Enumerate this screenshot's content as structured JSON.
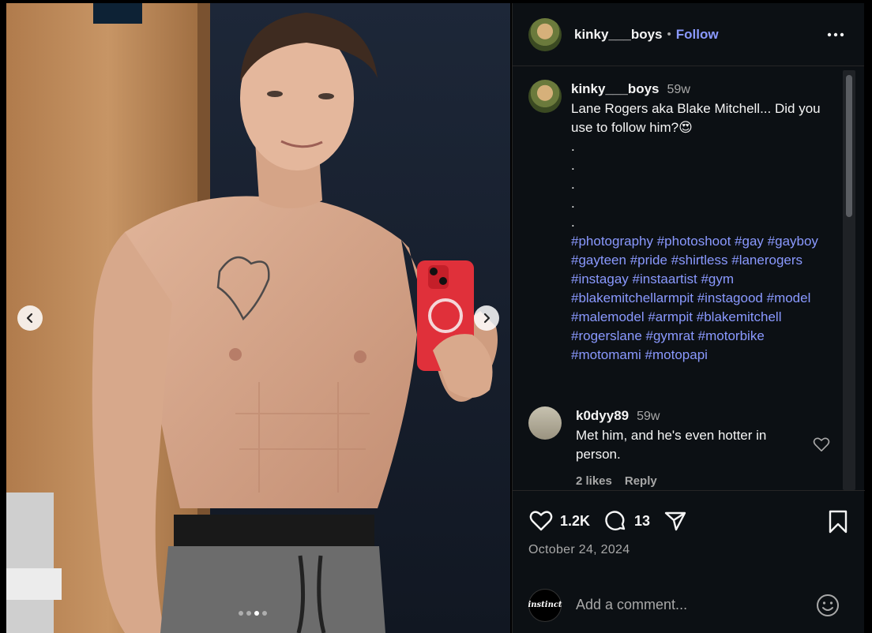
{
  "post": {
    "username": "kinky___boys",
    "separator": "•",
    "follow_label": "Follow",
    "more_label": "More options"
  },
  "caption": {
    "username": "kinky___boys",
    "time": "59w",
    "text": "Lane Rogers aka Blake Mitchell... Did you use to follow him?😍",
    "dots": [
      ".",
      ".",
      ".",
      ".",
      "."
    ],
    "hashtags": [
      "#photography",
      "#photoshoot",
      "#gay",
      "#gayboy",
      "#gayteen",
      "#pride",
      "#shirtless",
      "#lanerogers",
      "#instagay",
      "#instaartist",
      "#gym",
      "#blakemitchellarmpit",
      "#instagood",
      "#model",
      "#malemodel",
      "#armpit",
      "#blakemitchell",
      "#rogerslane",
      "#gymrat",
      "#motorbike",
      "#motomami",
      "#motopapi"
    ]
  },
  "comments": [
    {
      "username": "k0dyy89",
      "time": "59w",
      "text": "Met him, and he's even hotter in person.",
      "likes": "2 likes",
      "reply_label": "Reply"
    }
  ],
  "actions": {
    "likes_count": "1.2K",
    "comments_count": "13",
    "date": "October 24, 2024"
  },
  "composer": {
    "avatar_label": "instinct",
    "placeholder": "Add a comment..."
  },
  "carousel": {
    "slides": 4,
    "active_index": 2
  },
  "colors": {
    "panel_bg": "#0c1014",
    "link": "#8a99ff",
    "muted": "#a8a8a8",
    "text": "#f5f5f5",
    "phone_case": "#e0303a"
  },
  "icons": [
    "chevron-left-icon",
    "chevron-right-icon",
    "more-icon",
    "heart-icon",
    "comment-icon",
    "share-icon",
    "bookmark-icon",
    "emoji-icon"
  ]
}
